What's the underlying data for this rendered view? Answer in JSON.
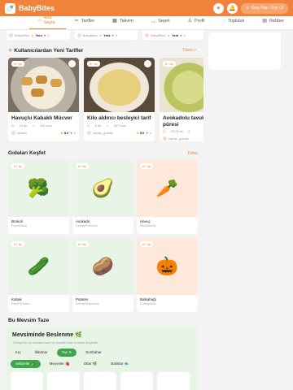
{
  "header": {
    "brand": "BabyBites",
    "login": "Giriş Yap / Üye Ol"
  },
  "nav": [
    {
      "label": "Ana Sayfa",
      "icon": "⌂"
    },
    {
      "label": "Tarifler",
      "icon": "✂"
    },
    {
      "label": "Takvim",
      "icon": "▦"
    },
    {
      "label": "Sepet",
      "icon": "◡"
    },
    {
      "label": "Profil",
      "icon": "♙"
    },
    {
      "label": "Topluluk",
      "icon": "◌"
    },
    {
      "label": "Rehber",
      "icon": "▤"
    }
  ],
  "strip": [
    {
      "user": "BabyBites",
      "score": "Yeni",
      "likes": "0"
    },
    {
      "user": "BabyBites",
      "score": "Yeni",
      "likes": "0"
    },
    {
      "user": "BabyBites",
      "score": "Yeni",
      "likes": "0"
    }
  ],
  "new_recipes": {
    "title": "Kullanıcılardan Yeni Tarifler",
    "link": "Tümü >",
    "items": [
      {
        "badge": "6+ ay",
        "title": "Havuçlu Kabaklı Mücver",
        "time": "15 dk",
        "kcal": "119 kcal",
        "user": "seyfan",
        "score": "5.0",
        "likes": "4"
      },
      {
        "badge": "6+ ay",
        "title": "Kilo aldırıcı besleyici tarif",
        "time": "5 dk",
        "kcal": "307 kcal",
        "user": "canan_gokalp",
        "score": "5.0",
        "likes": "4"
      },
      {
        "badge": "6+ ay",
        "title": "Avokadolu tavuk püresi",
        "time": "20-25 dk",
        "kcal": "3",
        "user": "canan_gokalp",
        "score": "",
        "likes": ""
      }
    ]
  },
  "foods": {
    "title": "Gıdaları Keşfet",
    "link": "Tümü",
    "items": [
      {
        "badge": "6+ ay",
        "name": "Brokoli",
        "cat": "Pişirilebilmiş",
        "icon": "broccoli-icon",
        "glyph": "🥦"
      },
      {
        "badge": "6+ ay",
        "name": "Avokado",
        "cat": "Ezilmiş/Pürüzsüz",
        "icon": "avocado-icon",
        "glyph": "🥑"
      },
      {
        "badge": "6+ ay",
        "name": "Havuç",
        "cat": "Pişirilebilmiş",
        "icon": "carrot-icon",
        "glyph": "🥕"
      },
      {
        "badge": "6+ ay",
        "name": "Kabak",
        "cat": "Püre/Pürüzsüz",
        "icon": "cucumber-icon",
        "glyph": "🥒"
      },
      {
        "badge": "6+ ay",
        "name": "Patates",
        "cat": "Ezilmiş/Haşlanmış",
        "icon": "potato-icon",
        "glyph": "🥔"
      },
      {
        "badge": "6+ ay",
        "name": "Balkabağı",
        "cat": "Ezilmiş/Dilim",
        "icon": "pumpkin-icon",
        "glyph": "🎃"
      }
    ]
  },
  "season": {
    "section_title": "Bu Mevsim Taze",
    "title": "Mevsiminde Beslenme 🌿",
    "subtitle": "Türkiye'de bu mevsim taze ve lezzetli olan ürünleri keşfedin",
    "seasons": [
      "Kış",
      "İlkbahar",
      "Yaz ☀",
      "Sonbahar"
    ],
    "active_season": 2,
    "cats": [
      "Sebzeler 🥦",
      "Meyveler 🍓",
      "Otlar 🌿",
      "Balıklar 🐟"
    ],
    "active_cat": 0
  },
  "colors": {
    "accent": "#f0823c",
    "green": "#3da64a"
  }
}
